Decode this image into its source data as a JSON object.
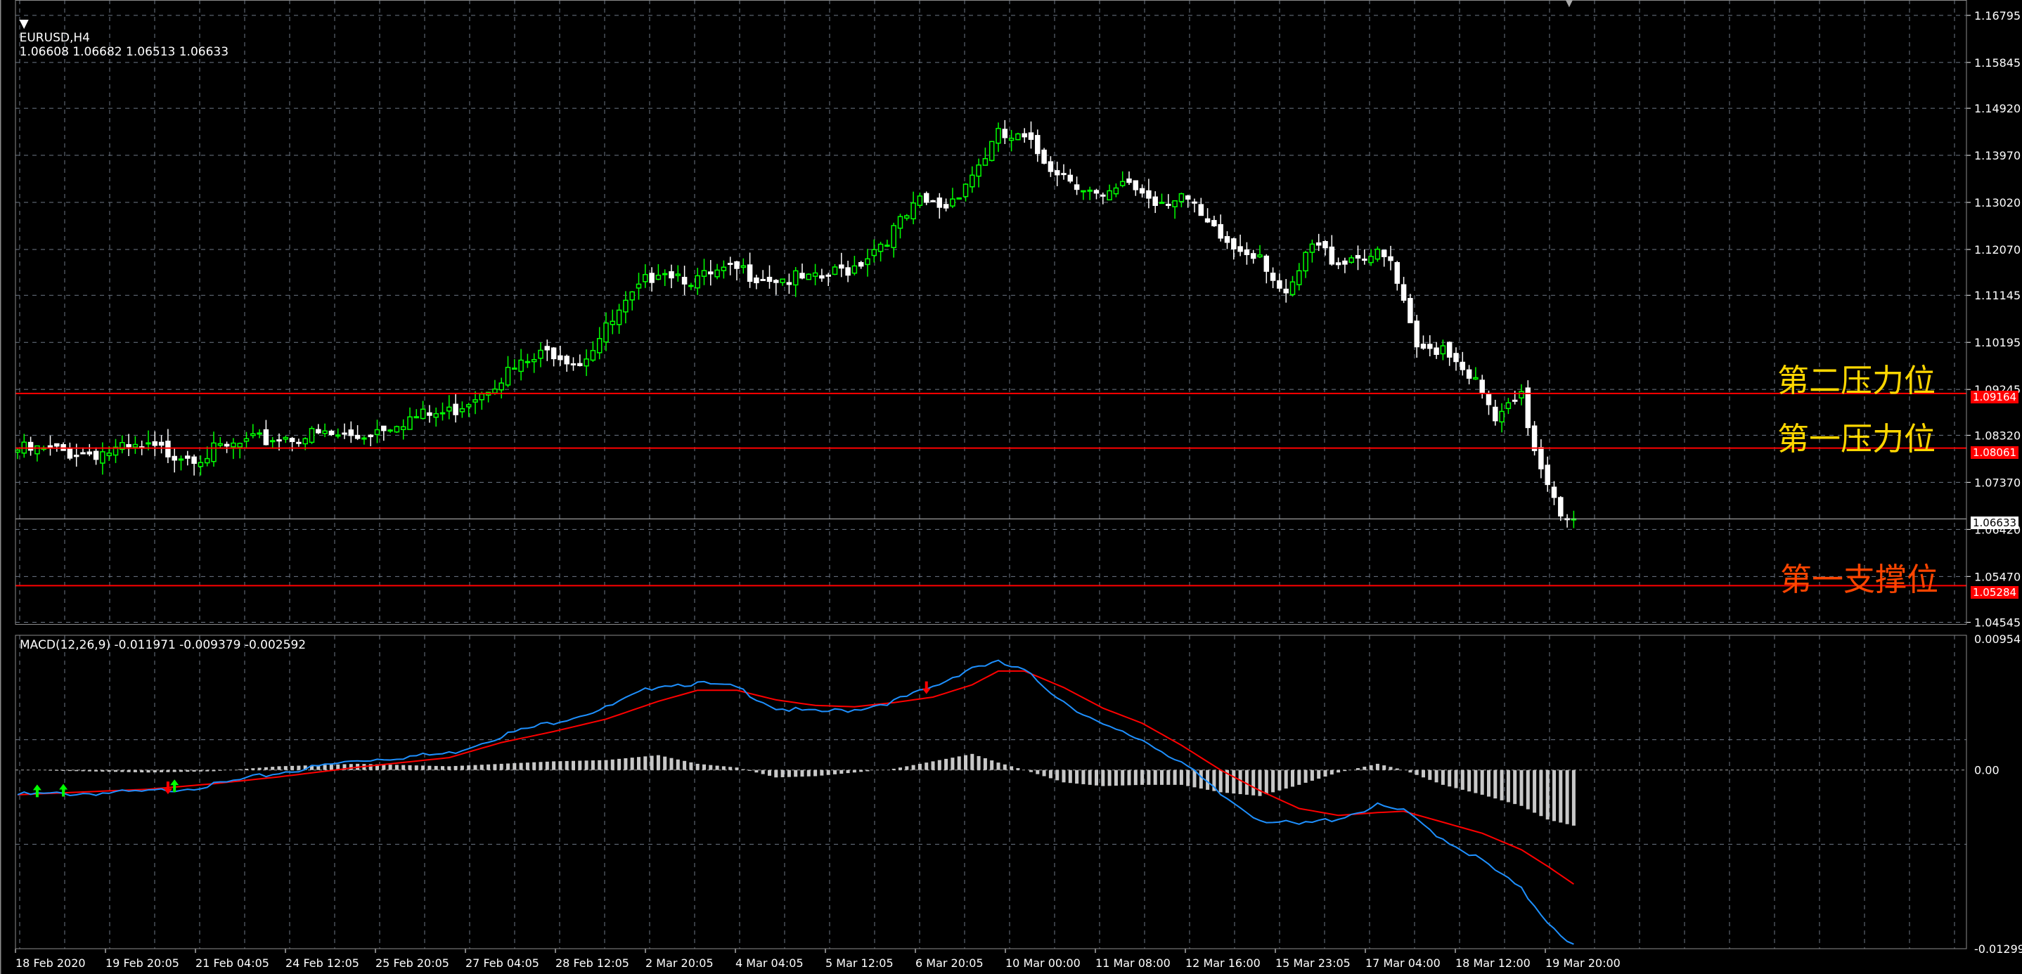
{
  "header": {
    "symbol": "EURUSD,H4",
    "ohlc": "1.06608 1.06682 1.06513 1.06633"
  },
  "macd_header": "MACD(12,26,9) -0.011971 -0.009379 -0.002592",
  "colors": {
    "background": "#000000",
    "grid": "#6e7886",
    "bull": "#00ff00",
    "bear": "#ffffff",
    "level_line": "#ff0000",
    "macd_line": "#1e90ff",
    "signal_line": "#ff0000",
    "histogram": "#c8c8c8"
  },
  "levels": [
    {
      "label": "第二压力位",
      "price": "1.09164",
      "color": "#ffd700"
    },
    {
      "label": "第一压力位",
      "price": "1.08061",
      "color": "#ffd700"
    },
    {
      "label": "第一支撑位",
      "price": "1.05284",
      "color": "#ff4500"
    }
  ],
  "current_price": "1.06633",
  "chart_data": [
    {
      "type": "candlestick",
      "title": "EURUSD,H4",
      "ylim": [
        1.0451,
        1.1685
      ],
      "y_ticks": [
        "1.16795",
        "1.15845",
        "1.14920",
        "1.13970",
        "1.13020",
        "1.12070",
        "1.11145",
        "1.10195",
        "1.09245",
        "1.08320",
        "1.07370",
        "1.06420",
        "1.05470",
        "1.04545"
      ],
      "x_labels": [
        "18 Feb 2020",
        "19 Feb 20:05",
        "21 Feb 04:05",
        "24 Feb 12:05",
        "25 Feb 20:05",
        "27 Feb 04:05",
        "28 Feb 12:05",
        "2 Mar 20:05",
        "4 Mar 04:05",
        "5 Mar 12:05",
        "6 Mar 20:05",
        "10 Mar 00:00",
        "11 Mar 08:00",
        "12 Mar 16:00",
        "15 Mar 23:05",
        "17 Mar 04:00",
        "18 Mar 12:00",
        "19 Mar 20:00"
      ],
      "close_anchors": [
        [
          0,
          1.0802
        ],
        [
          10,
          1.0797
        ],
        [
          20,
          1.0803
        ],
        [
          28,
          1.0792
        ],
        [
          34,
          1.0812
        ],
        [
          40,
          1.0828
        ],
        [
          46,
          1.0832
        ],
        [
          52,
          1.0829
        ],
        [
          58,
          1.0862
        ],
        [
          66,
          1.0878
        ],
        [
          74,
          1.0952
        ],
        [
          82,
          1.1003
        ],
        [
          86,
          1.0982
        ],
        [
          92,
          1.1075
        ],
        [
          98,
          1.1172
        ],
        [
          104,
          1.1145
        ],
        [
          110,
          1.1165
        ],
        [
          116,
          1.115
        ],
        [
          122,
          1.1142
        ],
        [
          128,
          1.1175
        ],
        [
          134,
          1.1245
        ],
        [
          138,
          1.13
        ],
        [
          142,
          1.1295
        ],
        [
          146,
          1.136
        ],
        [
          150,
          1.1435
        ],
        [
          154,
          1.1425
        ],
        [
          158,
          1.1378
        ],
        [
          162,
          1.1345
        ],
        [
          166,
          1.1302
        ],
        [
          170,
          1.1342
        ],
        [
          174,
          1.1305
        ],
        [
          178,
          1.132
        ],
        [
          182,
          1.125
        ],
        [
          186,
          1.121
        ],
        [
          190,
          1.1203
        ],
        [
          194,
          1.1102
        ],
        [
          198,
          1.1215
        ],
        [
          202,
          1.1185
        ],
        [
          206,
          1.12
        ],
        [
          210,
          1.118
        ],
        [
          214,
          1.1
        ],
        [
          218,
          1.1015
        ],
        [
          222,
          1.096
        ],
        [
          226,
          1.086
        ],
        [
          230,
          1.0905
        ],
        [
          232,
          1.0806
        ],
        [
          236,
          1.0683
        ],
        [
          238,
          1.0663
        ]
      ],
      "current": 1.06633
    },
    {
      "type": "line",
      "title": "MACD(12,26,9) -0.011971 -0.009379 -0.002592",
      "ylim": [
        -0.013,
        0.0098
      ],
      "y_ticks": [
        "0.00954",
        "0.00",
        "-0.01299"
      ],
      "series": [
        {
          "name": "MACD",
          "anchors": [
            [
              0,
              -0.0018
            ],
            [
              20,
              -0.0016
            ],
            [
              30,
              -0.0011
            ],
            [
              40,
              -0.0002
            ],
            [
              52,
              0.0007
            ],
            [
              66,
              0.0012
            ],
            [
              74,
              0.0025
            ],
            [
              82,
              0.0035
            ],
            [
              90,
              0.0045
            ],
            [
              98,
              0.0062
            ],
            [
              104,
              0.0063
            ],
            [
              110,
              0.006
            ],
            [
              116,
              0.0045
            ],
            [
              122,
              0.0042
            ],
            [
              128,
              0.0044
            ],
            [
              134,
              0.005
            ],
            [
              140,
              0.006
            ],
            [
              146,
              0.0075
            ],
            [
              150,
              0.0078
            ],
            [
              154,
              0.0072
            ],
            [
              160,
              0.005
            ],
            [
              166,
              0.0032
            ],
            [
              172,
              0.0022
            ],
            [
              178,
              0.0006
            ],
            [
              184,
              -0.0018
            ],
            [
              190,
              -0.0036
            ],
            [
              196,
              -0.004
            ],
            [
              202,
              -0.0035
            ],
            [
              208,
              -0.0026
            ],
            [
              212,
              -0.003
            ],
            [
              218,
              -0.005
            ],
            [
              224,
              -0.0066
            ],
            [
              230,
              -0.0087
            ],
            [
              234,
              -0.011
            ],
            [
              238,
              -0.0128
            ]
          ]
        },
        {
          "name": "Signal",
          "anchors": [
            [
              0,
              -0.0018
            ],
            [
              20,
              -0.0014
            ],
            [
              30,
              -0.001
            ],
            [
              40,
              -0.0005
            ],
            [
              52,
              0.0002
            ],
            [
              66,
              0.0009
            ],
            [
              74,
              0.002
            ],
            [
              82,
              0.0028
            ],
            [
              90,
              0.0037
            ],
            [
              98,
              0.005
            ],
            [
              104,
              0.0058
            ],
            [
              110,
              0.0058
            ],
            [
              116,
              0.0051
            ],
            [
              122,
              0.0047
            ],
            [
              128,
              0.0046
            ],
            [
              134,
              0.0049
            ],
            [
              140,
              0.0053
            ],
            [
              146,
              0.0062
            ],
            [
              150,
              0.0072
            ],
            [
              154,
              0.0072
            ],
            [
              160,
              0.006
            ],
            [
              166,
              0.0045
            ],
            [
              172,
              0.0034
            ],
            [
              178,
              0.0018
            ],
            [
              184,
              0.0
            ],
            [
              190,
              -0.0015
            ],
            [
              196,
              -0.0028
            ],
            [
              202,
              -0.0033
            ],
            [
              208,
              -0.0031
            ],
            [
              212,
              -0.003
            ],
            [
              218,
              -0.0038
            ],
            [
              224,
              -0.0046
            ],
            [
              230,
              -0.0058
            ],
            [
              234,
              -0.007
            ],
            [
              238,
              -0.0083
            ]
          ]
        }
      ],
      "signal_arrows": [
        {
          "bar": 3,
          "dir": "up",
          "color": "#00ff00"
        },
        {
          "bar": 7,
          "dir": "up",
          "color": "#00ff00"
        },
        {
          "bar": 23,
          "dir": "down",
          "color": "#ff0000"
        },
        {
          "bar": 24,
          "dir": "up",
          "color": "#00ff00"
        },
        {
          "bar": 139,
          "dir": "down",
          "color": "#ff0000"
        }
      ]
    }
  ]
}
